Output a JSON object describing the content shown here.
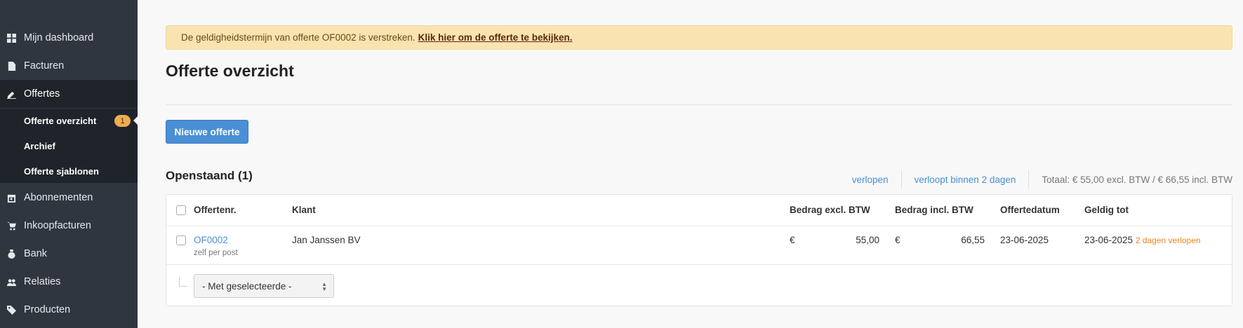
{
  "sidebar": {
    "items": [
      {
        "label": "Mijn dashboard",
        "icon": "grid-icon"
      },
      {
        "label": "Facturen",
        "icon": "file-icon"
      },
      {
        "label": "Offertes",
        "icon": "pencil-icon"
      },
      {
        "label": "Abonnementen",
        "icon": "calendar-icon"
      },
      {
        "label": "Inkoopfacturen",
        "icon": "cart-icon"
      },
      {
        "label": "Bank",
        "icon": "money-bag-icon"
      },
      {
        "label": "Relaties",
        "icon": "users-icon"
      },
      {
        "label": "Producten",
        "icon": "tag-icon"
      }
    ],
    "subitems": [
      {
        "label": "Offerte overzicht",
        "badge": "1"
      },
      {
        "label": "Archief"
      },
      {
        "label": "Offerte sjablonen"
      }
    ]
  },
  "alert": {
    "text": "De geldigheidstermijn van offerte OF0002 is verstreken.",
    "link": "Klik hier om de offerte te bekijken."
  },
  "page": {
    "title": "Offerte overzicht",
    "new_button": "Nieuwe offerte",
    "section_title": "Openstaand (1)"
  },
  "filters": {
    "expired": "verlopen",
    "expiring": "verloopt binnen 2 dagen",
    "total": "Totaal: € 55,00 excl. BTW / € 66,55 incl. BTW"
  },
  "table": {
    "headers": {
      "number": "Offertenr.",
      "client": "Klant",
      "excl": "Bedrag excl. BTW",
      "incl": "Bedrag incl. BTW",
      "date": "Offertedatum",
      "valid": "Geldig tot"
    },
    "rows": [
      {
        "number": "OF0002",
        "delivery": "zelf per post",
        "client": "Jan Janssen BV",
        "currency": "€",
        "excl": "55,00",
        "incl": "66,55",
        "date": "23-06-2025",
        "valid": "23-06-2025",
        "status": "2 dagen verlopen"
      }
    ],
    "bulk_select": "- Met geselecteerde -"
  },
  "colors": {
    "sidebar": "#2f3640",
    "accent": "#4a8fd4",
    "warning": "#f9e3b0",
    "badge": "#f0ad4e"
  }
}
